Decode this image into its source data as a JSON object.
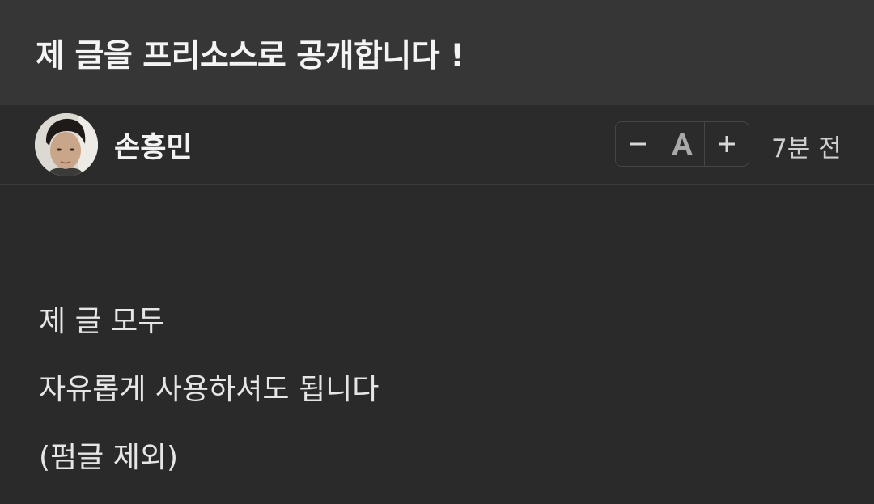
{
  "post": {
    "title": "제 글을 프리소스로 공개합니다 !"
  },
  "author": {
    "name": "손흥민",
    "avatar_icon": "user-avatar-photo"
  },
  "font_controls": {
    "decrease_icon": "minus-icon",
    "font_icon": "font-size-icon",
    "increase_icon": "plus-icon"
  },
  "meta": {
    "timestamp": "7분 전"
  },
  "content": {
    "lines": [
      "제 글 모두",
      "자유롭게 사용하셔도 됩니다",
      "(펌글 제외)"
    ]
  },
  "colors": {
    "background": "#2a2a2a",
    "title_bar": "#363636",
    "text": "#e6e6e6"
  }
}
